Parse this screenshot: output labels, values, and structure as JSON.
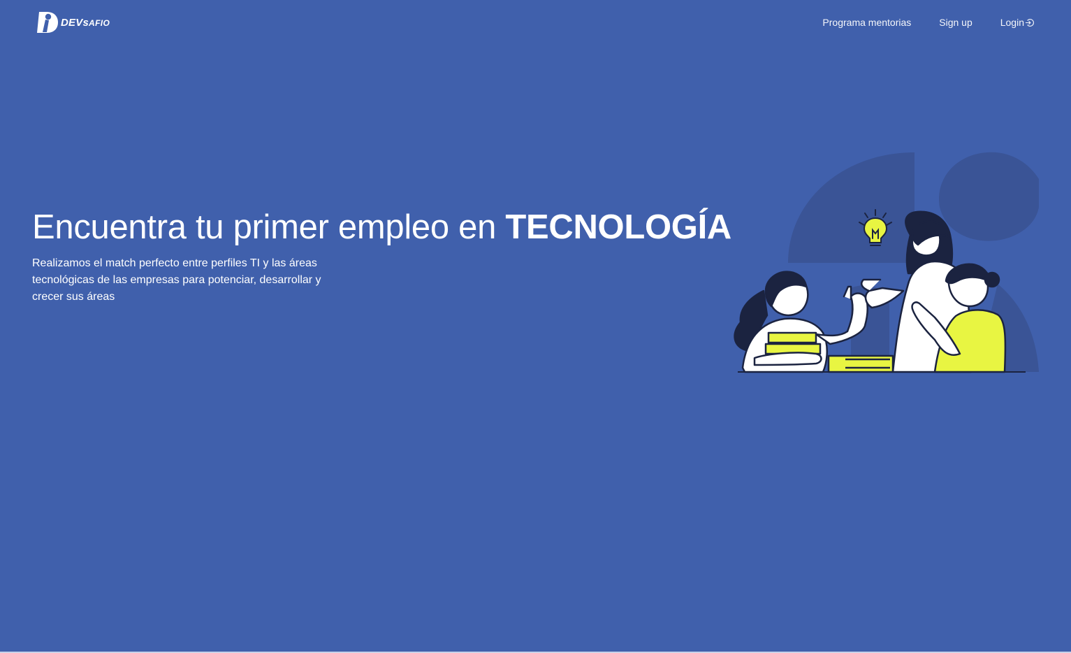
{
  "brand": {
    "name_big": "DEVs",
    "name_small": "AFIO"
  },
  "nav": {
    "links": [
      {
        "label": "Programa mentorias"
      },
      {
        "label": "Sign up"
      },
      {
        "label": "Login",
        "icon": "login-icon"
      }
    ]
  },
  "hero": {
    "title_regular": "Encuentra tu primer empleo en ",
    "title_bold": "TECNOLOGÍA",
    "subtitle": "Realizamos el match perfecto entre perfiles TI y las áreas tecnológicas de las empresas para potenciar, desarrollar y crecer sus áreas"
  },
  "colors": {
    "background": "#4060ac",
    "shape_dark": "#3a5496",
    "accent_yellow": "#e8f542",
    "ink": "#1b2340"
  }
}
